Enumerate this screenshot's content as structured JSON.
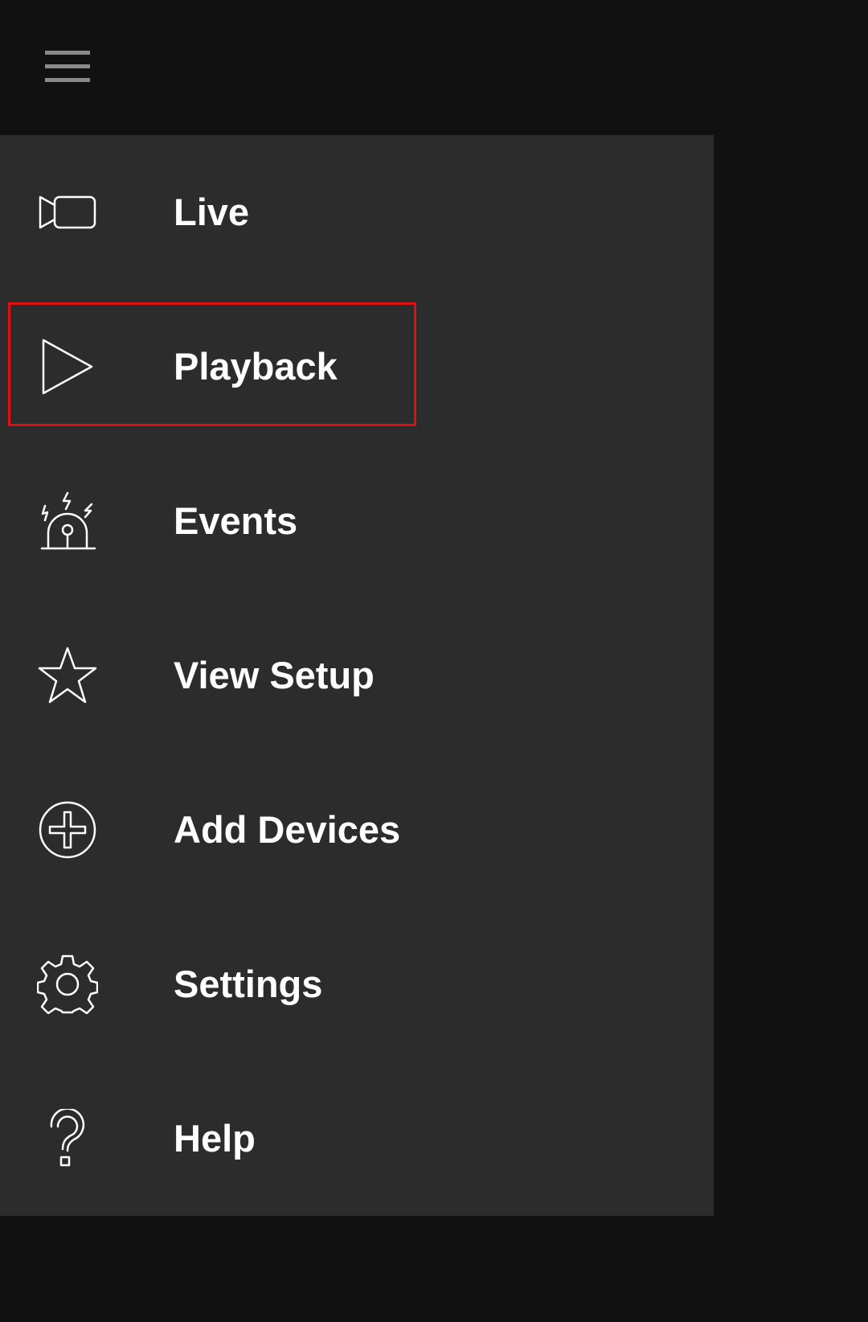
{
  "header": {
    "menu_icon": "hamburger-menu-icon"
  },
  "drawer": {
    "items": [
      {
        "label": "Live",
        "icon": "video-camera-icon"
      },
      {
        "label": "Playback",
        "icon": "play-icon",
        "highlighted": true
      },
      {
        "label": "Events",
        "icon": "alarm-siren-icon"
      },
      {
        "label": "View Setup",
        "icon": "star-icon"
      },
      {
        "label": "Add Devices",
        "icon": "add-circle-icon"
      },
      {
        "label": "Settings",
        "icon": "gear-icon"
      },
      {
        "label": "Help",
        "icon": "help-question-icon"
      }
    ]
  },
  "colors": {
    "background": "#111111",
    "drawer": "#2c2c2c",
    "text": "#ffffff",
    "highlight_border": "#e01010",
    "hamburger": "#8a8a8a"
  }
}
